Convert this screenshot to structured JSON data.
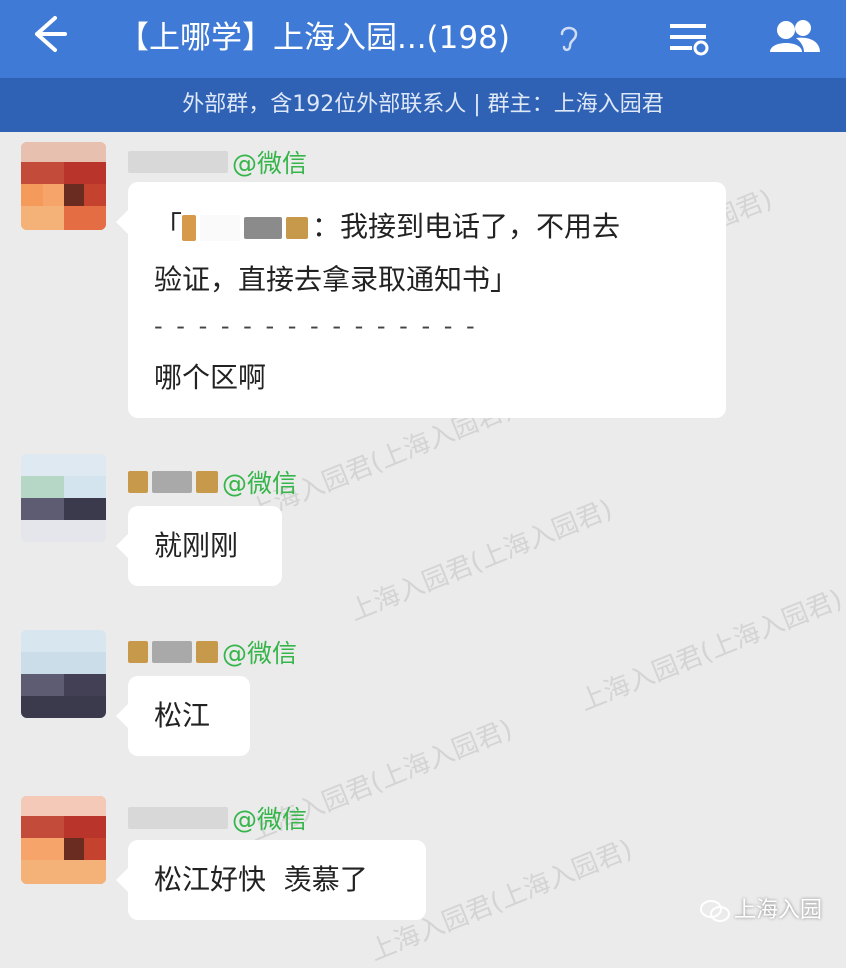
{
  "header": {
    "back_icon": "arrow-left-icon",
    "title": "【上哪学】上海入园...(198)",
    "ear_icon": "earpiece-icon",
    "menu_icon": "chat-settings-icon",
    "members_icon": "group-members-icon",
    "background": "#3f7ad6"
  },
  "subheader": {
    "text": "外部群，含192位外部联系人 | 群主：上海入园君",
    "background": "#2f62b5"
  },
  "messages": [
    {
      "sender_tag": "@微信",
      "quote_open": "「",
      "quote_sep": "：",
      "quote_text_1": "我接到电话了，不用去",
      "quote_text_2": "验证，直接去拿录取通知书」",
      "divider": "- - - - - - - - - - - - - - -",
      "reply": "哪个区啊"
    },
    {
      "sender_tag": "@微信",
      "text": "就刚刚"
    },
    {
      "sender_tag": "@微信",
      "text": "松江"
    },
    {
      "sender_tag": "@微信",
      "text": "松江好快  羡慕了"
    }
  ],
  "watermark": "上海入园君(上海入园君)",
  "footer": {
    "logo_icon": "wechat-icon",
    "label": "上海入园"
  },
  "colors": {
    "tag_green": "#36b54a",
    "chat_bg": "#ebebeb",
    "bubble": "#ffffff"
  }
}
